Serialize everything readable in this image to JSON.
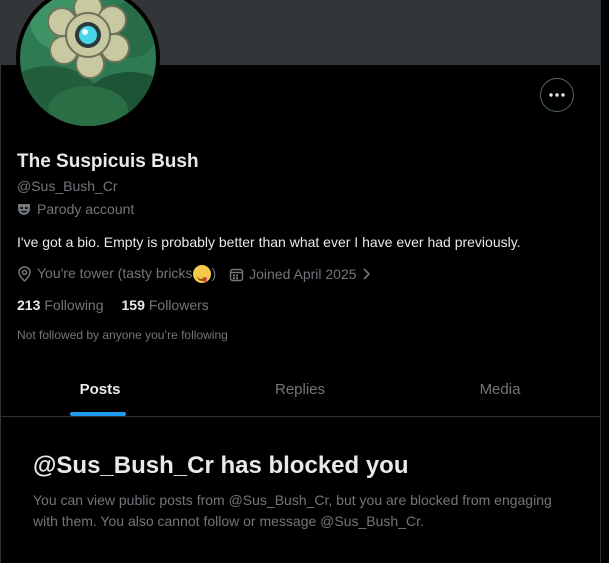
{
  "profile": {
    "name": "The Suspicuis Bush",
    "handle": "@Sus_Bush_Cr",
    "label": "Parody account",
    "bio": "I've got a bio. Empty is probably better than what ever I have ever had previously.",
    "location": "You're tower (tasty bricks",
    "location_suffix": ")",
    "joined": "Joined April 2025",
    "following_count": "213",
    "following_label": "Following",
    "followers_count": "159",
    "followers_label": "Followers",
    "not_followed_text": "Not followed by anyone you’re following"
  },
  "icons": {
    "more": "more-horizontal-icon",
    "parody": "mask-icon",
    "location": "location-pin-icon",
    "calendar": "calendar-icon",
    "chevron": "chevron-right-icon",
    "emoji": "yum-face-emoji-icon"
  },
  "tabs": [
    {
      "label": "Posts",
      "active": true
    },
    {
      "label": "Replies",
      "active": false
    },
    {
      "label": "Media",
      "active": false
    }
  ],
  "blocked": {
    "title": "@Sus_Bush_Cr has blocked you",
    "message": "You can view public posts from @Sus_Bush_Cr, but you are blocked from engaging with them. You also cannot follow or message @Sus_Bush_Cr."
  },
  "colors": {
    "accent": "#1d9bf0",
    "background": "#000000",
    "banner": "#333639",
    "secondary_text": "#71767b",
    "primary_text": "#e7e9ea"
  }
}
